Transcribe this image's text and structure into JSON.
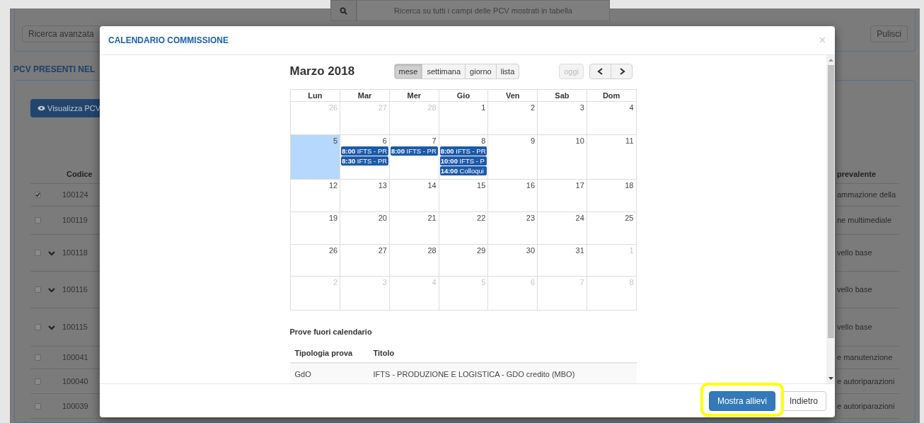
{
  "background": {
    "search": {
      "placeholder": "Ricerca su tutti i campi delle PCV mostrati in tabella"
    },
    "advanced_button": "Ricerca avanzata",
    "clear_button": "Pulisci",
    "section_title": "PCV PRESENTI NEL",
    "view_button": "Visualizza PCV",
    "table": {
      "columns": [
        "Codice",
        "prevalente"
      ],
      "rows": [
        {
          "code": "100124",
          "checked": true,
          "expandable": false,
          "column_2": "ammazione della"
        },
        {
          "code": "100119",
          "checked": false,
          "expandable": false,
          "column_2": "ne multimediale"
        },
        {
          "code": "100118",
          "checked": false,
          "expandable": true,
          "column_2": "vello base"
        },
        {
          "code": "100116",
          "checked": false,
          "expandable": true,
          "column_2": "vello base"
        },
        {
          "code": "100115",
          "checked": false,
          "expandable": true,
          "column_2": "vello base"
        },
        {
          "code": "100041",
          "checked": false,
          "expandable": false,
          "column_2": "e manutenzione"
        },
        {
          "code": "100040",
          "checked": false,
          "expandable": false,
          "column_2": "e autoriparazioni"
        },
        {
          "code": "100039",
          "checked": false,
          "expandable": false,
          "column_2": "e autoriparazioni"
        }
      ]
    }
  },
  "modal": {
    "title": "CALENDARIO COMMISSIONE",
    "close": "×",
    "calendar": {
      "title": "Marzo 2018",
      "views": [
        {
          "label": "mese",
          "selected": true
        },
        {
          "label": "settimana",
          "selected": false
        },
        {
          "label": "giorno",
          "selected": false
        },
        {
          "label": "lista",
          "selected": false
        }
      ],
      "today_button": {
        "label": "oggi",
        "disabled": true
      },
      "weekdays": [
        "Lun",
        "Mar",
        "Mer",
        "Gio",
        "Ven",
        "Sab",
        "Dom"
      ],
      "weeks": [
        [
          {
            "day": "26",
            "other_month": true,
            "today": false
          },
          {
            "day": "27",
            "other_month": true,
            "today": false
          },
          {
            "day": "28",
            "other_month": true,
            "today": false
          },
          {
            "day": "1",
            "other_month": false,
            "today": false
          },
          {
            "day": "2",
            "other_month": false,
            "today": false
          },
          {
            "day": "3",
            "other_month": false,
            "today": false
          },
          {
            "day": "4",
            "other_month": false,
            "today": false
          }
        ],
        [
          {
            "day": "5",
            "other_month": false,
            "today": true
          },
          {
            "day": "6",
            "other_month": false,
            "today": false,
            "events": [
              {
                "time": "8:00",
                "title": "IFTS - PR"
              },
              {
                "time": "8:30",
                "title": "IFTS - PR"
              }
            ]
          },
          {
            "day": "7",
            "other_month": false,
            "today": false,
            "events": [
              {
                "time": "8:00",
                "title": "IFTS - PR"
              }
            ]
          },
          {
            "day": "8",
            "other_month": false,
            "today": false,
            "events": [
              {
                "time": "8:00",
                "title": "IFTS - PR"
              },
              {
                "time": "10:00",
                "title": "IFTS - P"
              },
              {
                "time": "14:00",
                "title": "Colloqui"
              }
            ]
          },
          {
            "day": "9",
            "other_month": false,
            "today": false
          },
          {
            "day": "10",
            "other_month": false,
            "today": false
          },
          {
            "day": "11",
            "other_month": false,
            "today": false
          }
        ],
        [
          {
            "day": "12",
            "other_month": false,
            "today": false
          },
          {
            "day": "13",
            "other_month": false,
            "today": false
          },
          {
            "day": "14",
            "other_month": false,
            "today": false
          },
          {
            "day": "15",
            "other_month": false,
            "today": false
          },
          {
            "day": "16",
            "other_month": false,
            "today": false
          },
          {
            "day": "17",
            "other_month": false,
            "today": false
          },
          {
            "day": "18",
            "other_month": false,
            "today": false
          }
        ],
        [
          {
            "day": "19",
            "other_month": false,
            "today": false
          },
          {
            "day": "20",
            "other_month": false,
            "today": false
          },
          {
            "day": "21",
            "other_month": false,
            "today": false
          },
          {
            "day": "22",
            "other_month": false,
            "today": false
          },
          {
            "day": "23",
            "other_month": false,
            "today": false
          },
          {
            "day": "24",
            "other_month": false,
            "today": false
          },
          {
            "day": "25",
            "other_month": false,
            "today": false
          }
        ],
        [
          {
            "day": "26",
            "other_month": false,
            "today": false
          },
          {
            "day": "27",
            "other_month": false,
            "today": false
          },
          {
            "day": "28",
            "other_month": false,
            "today": false
          },
          {
            "day": "29",
            "other_month": false,
            "today": false
          },
          {
            "day": "30",
            "other_month": false,
            "today": false
          },
          {
            "day": "31",
            "other_month": false,
            "today": false
          },
          {
            "day": "1",
            "other_month": true,
            "today": false
          }
        ],
        [
          {
            "day": "2",
            "other_month": true,
            "today": false
          },
          {
            "day": "3",
            "other_month": true,
            "today": false
          },
          {
            "day": "4",
            "other_month": true,
            "today": false
          },
          {
            "day": "5",
            "other_month": true,
            "today": false
          },
          {
            "day": "6",
            "other_month": true,
            "today": false
          },
          {
            "day": "7",
            "other_month": true,
            "today": false
          },
          {
            "day": "8",
            "other_month": true,
            "today": false
          }
        ]
      ]
    },
    "off_calendar": {
      "title": "Prove fuori calendario",
      "columns": [
        "Tipologia prova",
        "Titolo"
      ],
      "rows": [
        [
          "GdO",
          "IFTS - PRODUZIONE E LOGISTICA - GDO credito (MBO)"
        ]
      ]
    },
    "footer_buttons": [
      {
        "label": "Mostra allievi",
        "kind": "primary"
      },
      {
        "label": "Indietro",
        "kind": "default"
      }
    ]
  },
  "annotation": {
    "highlight_frame": true
  }
}
